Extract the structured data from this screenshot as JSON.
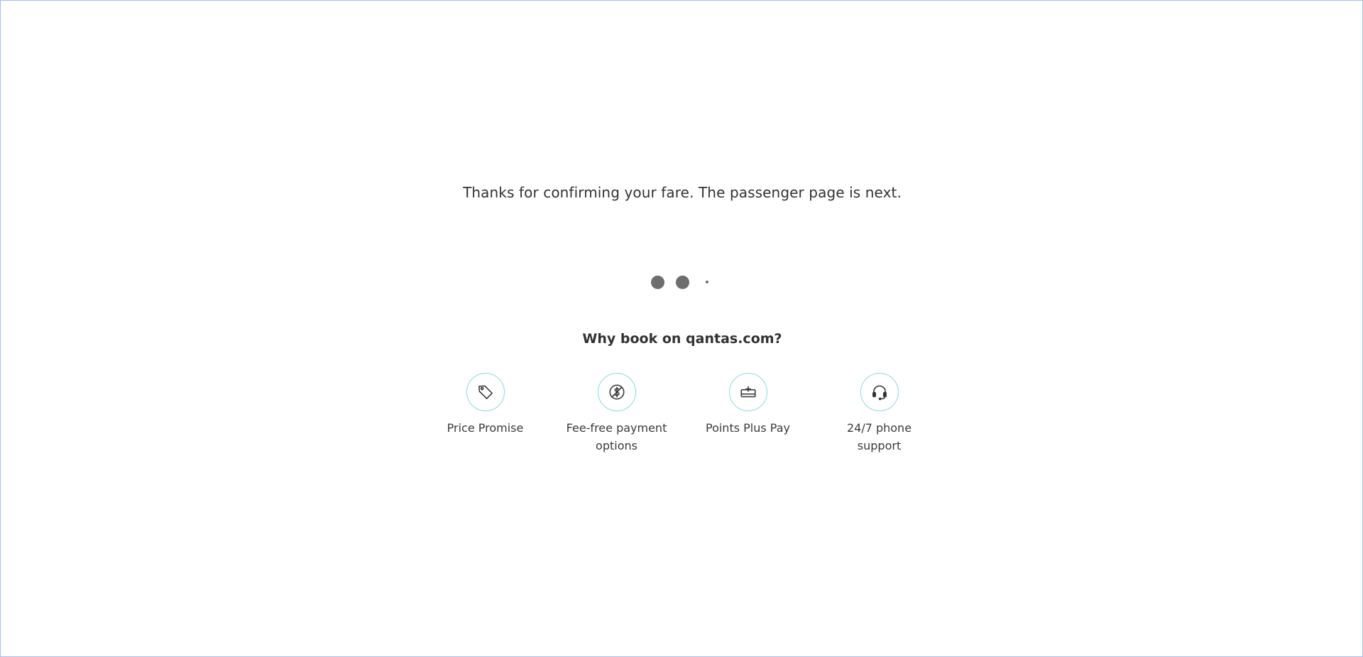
{
  "message": "Thanks for confirming your fare. The passenger page is next.",
  "loader": {
    "dot_color": "#6e6e6e"
  },
  "why": {
    "title": "Why book on qantas.com?"
  },
  "features": [
    {
      "label": "Price Promise",
      "icon": "price-tag-icon"
    },
    {
      "label": "Fee-free payment options",
      "icon": "dollar-circle-icon"
    },
    {
      "label": "Points Plus Pay",
      "icon": "card-plus-icon"
    },
    {
      "label": "24/7 phone support",
      "icon": "headset-icon"
    }
  ],
  "colors": {
    "icon_ring": "#8ad9dd",
    "text": "#323232",
    "frame_border": "#a9bdf2"
  }
}
